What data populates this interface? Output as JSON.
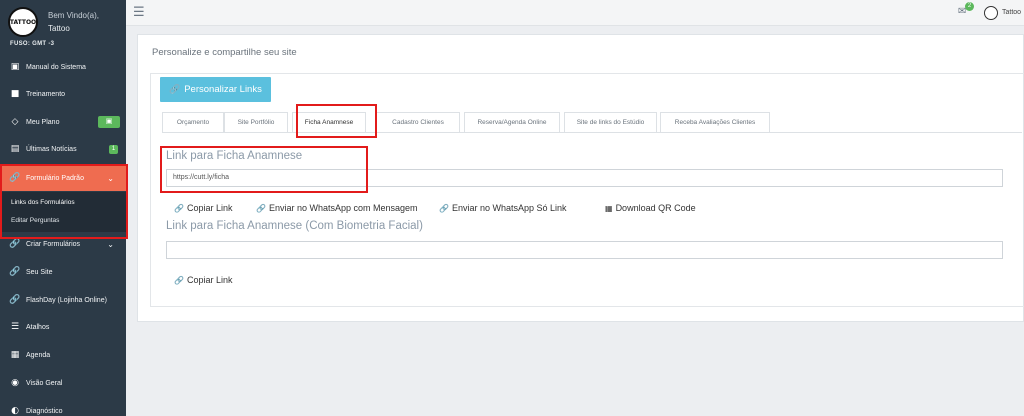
{
  "brand": {
    "logo_text": "TATTOO",
    "welcome": "Bem Vindo(a),",
    "user": "Tattoo",
    "timezone": "FUSO: GMT -3"
  },
  "sidebar": {
    "items": [
      {
        "label": "Manual do Sistema",
        "icon": "book-icon"
      },
      {
        "label": "Treinamento",
        "icon": "video-icon"
      },
      {
        "label": "Meu Plano",
        "icon": "diamond-icon",
        "badge": "gift-icon"
      },
      {
        "label": "Últimas Notícias",
        "icon": "newspaper-icon",
        "badge": "1"
      },
      {
        "label": "Formulário Padrão",
        "icon": "link-icon"
      },
      {
        "label": "Criar Formulários",
        "icon": "link-icon"
      },
      {
        "label": "Seu Site",
        "icon": "link-icon"
      },
      {
        "label": "FlashDay (Lojinha Online)",
        "icon": "link-icon"
      },
      {
        "label": "Atalhos",
        "icon": "signpost-icon"
      },
      {
        "label": "Agenda",
        "icon": "calendar-icon"
      },
      {
        "label": "Visão Geral",
        "icon": "eye-icon"
      },
      {
        "label": "Diagnóstico",
        "icon": "gauge-icon"
      }
    ],
    "subitems": [
      "Links dos Formulários",
      "Editar Perguntas"
    ]
  },
  "topbar": {
    "mail_count": "2",
    "user": "Tattoo"
  },
  "main": {
    "title": "Personalize e compartilhe seu site",
    "personalize_button": "Personalizar Links",
    "tabs": [
      "Orçamento",
      "Site Portfólio",
      "Ficha Anamnese",
      "Cadastro Clientes",
      "Reserva/Agenda Online",
      "Site de links do Estúdio",
      "Receba Avaliações Clientes"
    ],
    "section1": {
      "title": "Link para Ficha Anamnese",
      "url": "https://cutt.ly/ficha",
      "actions": [
        "Copiar Link",
        "Enviar no WhatsApp com Mensagem",
        "Enviar no WhatsApp Só Link",
        "Download QR Code"
      ]
    },
    "section2": {
      "title": "Link para Ficha Anamnese (Com Biometria Facial)",
      "url": "",
      "actions": [
        "Copiar Link"
      ]
    }
  }
}
